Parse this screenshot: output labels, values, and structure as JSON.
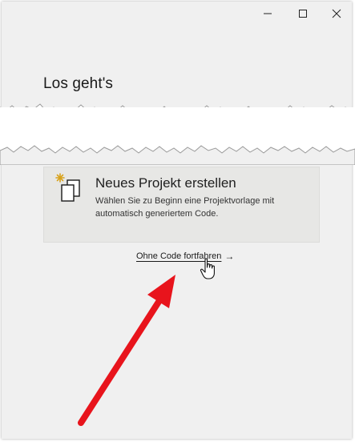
{
  "window": {
    "controls": {
      "minimize": "–",
      "maximize": "☐",
      "close": "✕"
    }
  },
  "page": {
    "title": "Los geht's"
  },
  "card": {
    "icon": "new-project-icon",
    "title": "Neues Projekt erstellen",
    "description": "Wählen Sie zu Beginn eine Projektvorlage mit automatisch generiertem Code."
  },
  "link": {
    "label": "Ohne Code fortfahren",
    "arrow": "→"
  },
  "colors": {
    "window_bg": "#f0f0f0",
    "card_bg": "#e7e7e5",
    "annotation_arrow": "#e8141c",
    "icon_accent": "#d8a21b"
  }
}
